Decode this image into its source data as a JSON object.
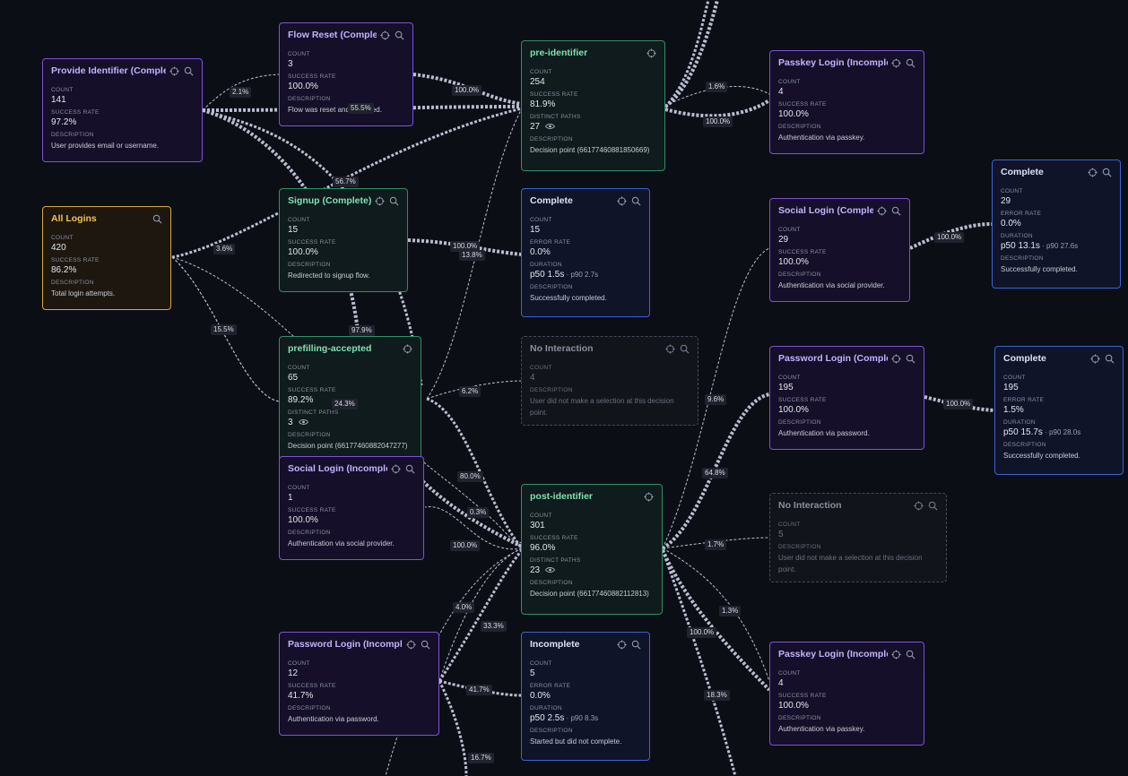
{
  "nodes": {
    "provide_identifier": {
      "title": "Provide Identifier (Complete)",
      "count_label": "COUNT",
      "count": "141",
      "metric_label": "SUCCESS RATE",
      "metric": "97.2%",
      "desc_label": "DESCRIPTION",
      "desc": "User provides email or username."
    },
    "flow_reset": {
      "title": "Flow Reset (Complete)",
      "count_label": "COUNT",
      "count": "3",
      "metric_label": "SUCCESS RATE",
      "metric": "100.0%",
      "desc_label": "DESCRIPTION",
      "desc": "Flow was reset and restarted."
    },
    "pre_identifier": {
      "title": "pre-identifier",
      "count_label": "COUNT",
      "count": "254",
      "metric_label": "SUCCESS RATE",
      "metric": "81.9%",
      "paths_label": "DISTINCT PATHS",
      "paths": "27",
      "desc_label": "DESCRIPTION",
      "desc": "Decision point (66177460881850669)"
    },
    "passkey_top": {
      "title": "Passkey Login (Incomplete)",
      "count_label": "COUNT",
      "count": "4",
      "metric_label": "SUCCESS RATE",
      "metric": "100.0%",
      "desc_label": "DESCRIPTION",
      "desc": "Authentication via passkey."
    },
    "complete_right_top": {
      "title": "Complete",
      "count_label": "COUNT",
      "count": "29",
      "metric_label": "ERROR RATE",
      "metric": "0.0%",
      "dur_label": "DURATION",
      "dur": "p50 13.1s",
      "dur_sub": " · p90 27.6s",
      "desc_label": "DESCRIPTION",
      "desc": "Successfully completed."
    },
    "all_logins": {
      "title": "All Logins",
      "count_label": "COUNT",
      "count": "420",
      "metric_label": "SUCCESS RATE",
      "metric": "86.2%",
      "desc_label": "DESCRIPTION",
      "desc": "Total login attempts."
    },
    "signup": {
      "title": "Signup (Complete)",
      "count_label": "COUNT",
      "count": "15",
      "metric_label": "SUCCESS RATE",
      "metric": "100.0%",
      "desc_label": "DESCRIPTION",
      "desc": "Redirected to signup flow."
    },
    "complete_mid": {
      "title": "Complete",
      "count_label": "COUNT",
      "count": "15",
      "metric_label": "ERROR RATE",
      "metric": "0.0%",
      "dur_label": "DURATION",
      "dur": "p50 1.5s",
      "dur_sub": " · p90 2.7s",
      "desc_label": "DESCRIPTION",
      "desc": "Successfully completed."
    },
    "social_complete": {
      "title": "Social Login (Complete)",
      "count_label": "COUNT",
      "count": "29",
      "metric_label": "SUCCESS RATE",
      "metric": "100.0%",
      "desc_label": "DESCRIPTION",
      "desc": "Authentication via social provider."
    },
    "prefilling": {
      "title": "prefilling-accepted",
      "count_label": "COUNT",
      "count": "65",
      "metric_label": "SUCCESS RATE",
      "metric": "89.2%",
      "paths_label": "DISTINCT PATHS",
      "paths": "3",
      "desc_label": "DESCRIPTION",
      "desc": "Decision point (66177460882047277)"
    },
    "no_interaction_1": {
      "title": "No Interaction",
      "count_label": "COUNT",
      "count": "4",
      "desc_label": "DESCRIPTION",
      "desc": "User did not make a selection at this decision point."
    },
    "password_complete": {
      "title": "Password Login (Complete)",
      "count_label": "COUNT",
      "count": "195",
      "metric_label": "SUCCESS RATE",
      "metric": "100.0%",
      "desc_label": "DESCRIPTION",
      "desc": "Authentication via password."
    },
    "complete_right_mid": {
      "title": "Complete",
      "count_label": "COUNT",
      "count": "195",
      "metric_label": "ERROR RATE",
      "metric": "1.5%",
      "dur_label": "DURATION",
      "dur": "p50 15.7s",
      "dur_sub": " · p90 28.0s",
      "desc_label": "DESCRIPTION",
      "desc": "Successfully completed."
    },
    "social_incomplete": {
      "title": "Social Login (Incomplete)",
      "count_label": "COUNT",
      "count": "1",
      "metric_label": "SUCCESS RATE",
      "metric": "100.0%",
      "desc_label": "DESCRIPTION",
      "desc": "Authentication via social provider."
    },
    "post_identifier": {
      "title": "post-identifier",
      "count_label": "COUNT",
      "count": "301",
      "metric_label": "SUCCESS RATE",
      "metric": "96.0%",
      "paths_label": "DISTINCT PATHS",
      "paths": "23",
      "desc_label": "DESCRIPTION",
      "desc": "Decision point (66177460882112813)"
    },
    "no_interaction_2": {
      "title": "No Interaction",
      "count_label": "COUNT",
      "count": "5",
      "desc_label": "DESCRIPTION",
      "desc": "User did not make a selection at this decision point."
    },
    "password_incomplete": {
      "title": "Password Login (Incomplete)",
      "count_label": "COUNT",
      "count": "12",
      "metric_label": "SUCCESS RATE",
      "metric": "41.7%",
      "desc_label": "DESCRIPTION",
      "desc": "Authentication via password."
    },
    "incomplete": {
      "title": "Incomplete",
      "count_label": "COUNT",
      "count": "5",
      "metric_label": "ERROR RATE",
      "metric": "0.0%",
      "dur_label": "DURATION",
      "dur": "p50 2.5s",
      "dur_sub": " · p90 8.3s",
      "desc_label": "DESCRIPTION",
      "desc": "Started but did not complete."
    },
    "passkey_bottom": {
      "title": "Passkey Login (Incomplete)",
      "count_label": "COUNT",
      "count": "4",
      "metric_label": "SUCCESS RATE",
      "metric": "100.0%",
      "desc_label": "DESCRIPTION",
      "desc": "Authentication via passkey."
    }
  },
  "edge_labels": [
    "2.1%",
    "55.5%",
    "100.0%",
    "1.6%",
    "100.0%",
    "56.7%",
    "3.6%",
    "100.0%",
    "13.8%",
    "100.0%",
    "15.5%",
    "97.9%",
    "24.3%",
    "6.2%",
    "9.6%",
    "100.0%",
    "80.0%",
    "64.8%",
    "0.3%",
    "100.0%",
    "1.7%",
    "4.0%",
    "1.3%",
    "33.3%",
    "100.0%",
    "41.7%",
    "18.3%",
    "16.7%"
  ],
  "icons": {
    "target": "target-icon",
    "search": "search-icon",
    "eye": "eye-icon"
  },
  "colors": {
    "background": "#0c0e16",
    "edge": "#b9bfd0",
    "purple": "#7c52d8",
    "green": "#2f8f64",
    "blue": "#3d62d2",
    "yellow": "#d6a83a"
  }
}
